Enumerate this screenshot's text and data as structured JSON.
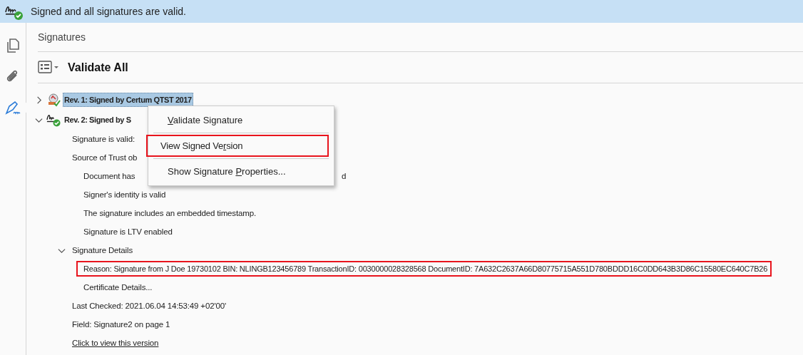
{
  "banner": {
    "text": "Signed and all signatures are valid."
  },
  "rail": [
    {
      "kind": "pages",
      "selected": false
    },
    {
      "kind": "attachments",
      "selected": false
    },
    {
      "kind": "signatures",
      "selected": true
    }
  ],
  "panel": {
    "title": "Signatures",
    "toolbar": {
      "action": "Validate All"
    }
  },
  "tree": [
    {
      "label": "Rev. 1: Signed by Certum QTST 2017",
      "expanded": false,
      "selected": true
    },
    {
      "label": "Rev. 2: Signed by S",
      "expanded": true,
      "selected": false,
      "children": [
        {
          "label": "Signature is valid:"
        },
        {
          "label": "Source of Trust ob",
          "children": [
            {
              "label": "Document has",
              "tail": "d",
              "highlighted": false
            },
            {
              "label": "Signer's identity is valid",
              "highlighted": false
            },
            {
              "label": "The signature includes an embedded timestamp.",
              "highlighted": false
            },
            {
              "label": "Signature is LTV enabled",
              "highlighted": false
            }
          ]
        },
        {
          "label": "Signature Details",
          "expanded": true,
          "children": [
            {
              "label": "Reason: Signature from J Doe 19730102  BIN: NLINGB123456789 TransactionID:  0030000028328568 DocumentID: 7A632C2637A66D80775715A551D780BDDD16C0DD643B3D86C15580EC640C7B26",
              "highlighted": true
            },
            {
              "label": "Certificate Details...",
              "highlighted": false
            }
          ]
        },
        {
          "label": "Last Checked: 2021.06.04 14:53:49 +02'00'"
        },
        {
          "label": "Field: Signature2 on page 1"
        },
        {
          "label": "Click to view this version",
          "kind": "link"
        }
      ]
    }
  ],
  "context_menu": [
    {
      "key": "V",
      "post": "alidate Signature",
      "highlighted": false
    },
    {
      "pre": "View Signed Ve",
      "key": "r",
      "post": "sion",
      "highlighted": true
    },
    {
      "pre": "Show Signature ",
      "key": "P",
      "post": "roperties...",
      "highlighted": false
    }
  ]
}
